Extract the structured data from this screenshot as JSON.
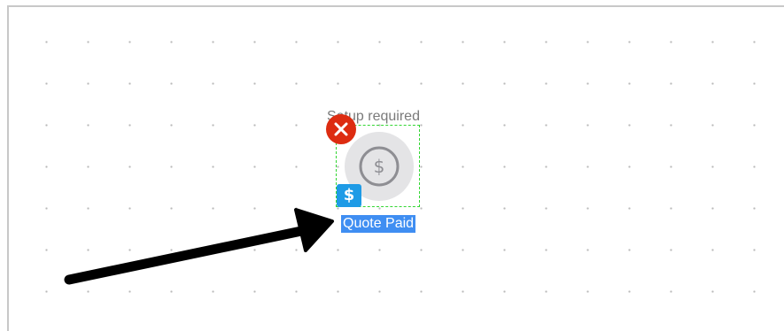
{
  "canvas": {
    "grid": "dotted"
  },
  "node": {
    "status_text": "Setup required",
    "label": "Quote Paid",
    "icon": "dollar-circle-icon",
    "type_badge": "$",
    "remove_icon": "close-icon"
  },
  "colors": {
    "remove": "#dd2c11",
    "badge": "#1e9be6",
    "selection": "#3f8ef2",
    "node_outline": "#33d633",
    "node_fill": "#e4e4e6",
    "arrow": "#000000"
  }
}
